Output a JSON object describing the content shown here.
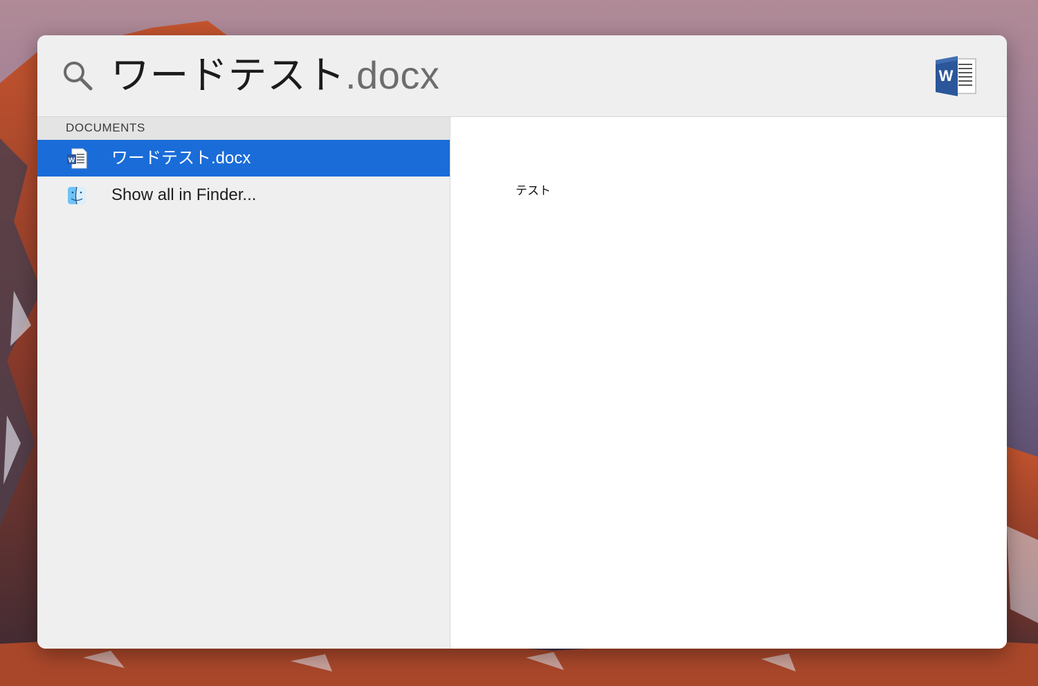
{
  "search": {
    "query_typed": "ワードテスト",
    "query_completion": ".docx"
  },
  "results": {
    "section_header": "DOCUMENTS",
    "items": [
      {
        "label": "ワードテスト.docx",
        "icon": "word-document-icon",
        "selected": true
      },
      {
        "label": "Show all in Finder...",
        "icon": "finder-icon",
        "selected": false
      }
    ]
  },
  "preview": {
    "content_text": "テスト"
  },
  "colors": {
    "selection": "#1a6cd8",
    "word_blue": "#2b579a",
    "panel_bg": "#efefef",
    "preview_bg": "#ffffff"
  }
}
